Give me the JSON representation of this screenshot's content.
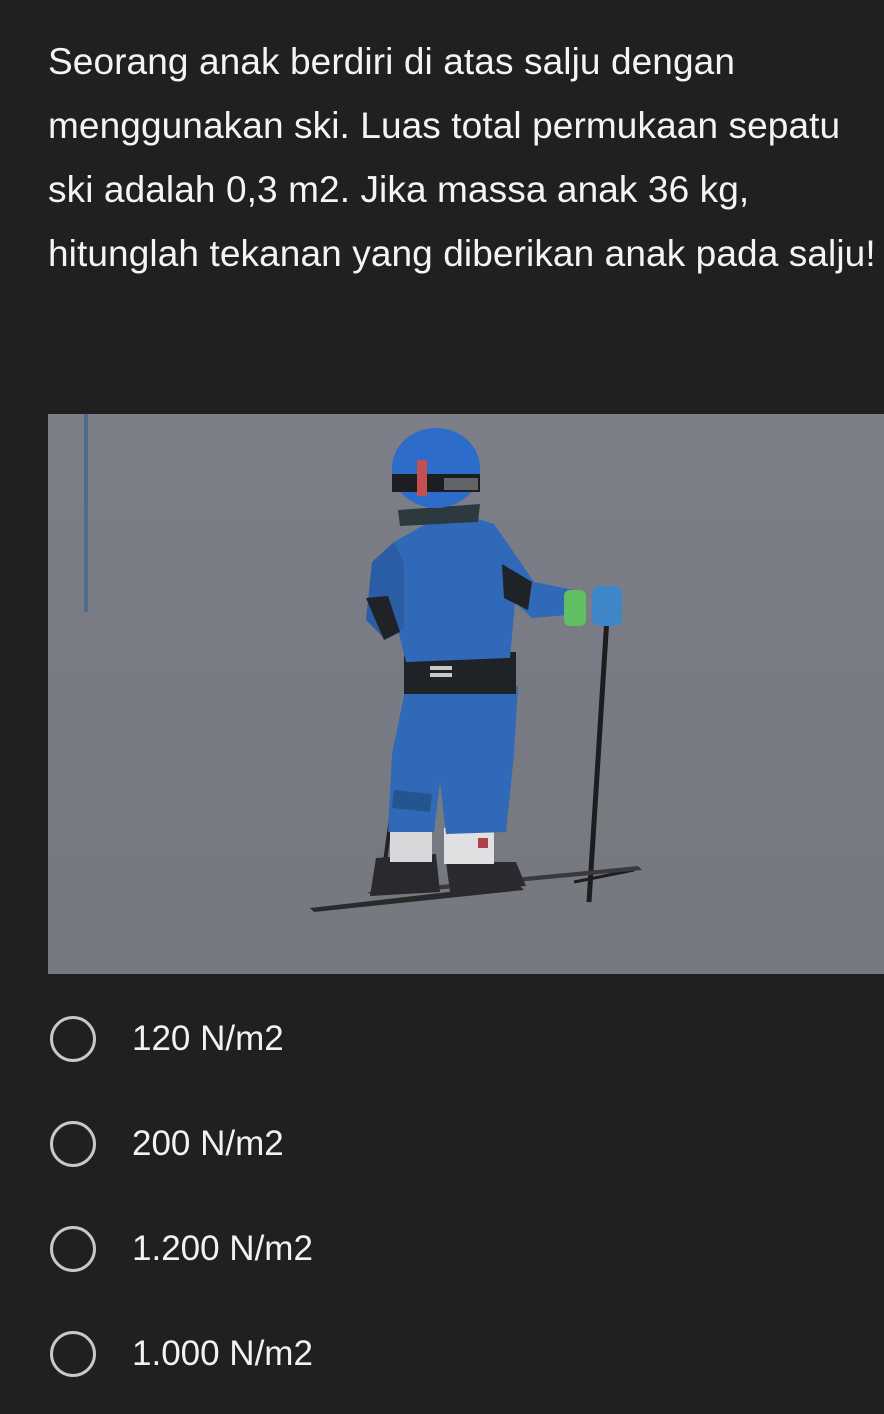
{
  "question": {
    "text": "Seorang anak berdiri di atas salju dengan menggunakan ski. Luas total permukaan sepatu ski adalah 0,3 m2. Jika massa anak 36 kg, hitunglah tekanan yang diberikan anak pada salju!"
  },
  "image": {
    "subject": "child skiing on snow"
  },
  "options": [
    {
      "label": "120 N/m2"
    },
    {
      "label": "200 N/m2"
    },
    {
      "label": "1.200 N/m2"
    },
    {
      "label": "1.000 N/m2"
    }
  ],
  "icons": {
    "radio": "radio-unchecked-icon"
  },
  "colors": {
    "background": "#202021",
    "text": "#f4f4f4",
    "radio_border": "#c8c8c8",
    "snow": "#7a7c86",
    "jacket": "#2f69b8"
  }
}
